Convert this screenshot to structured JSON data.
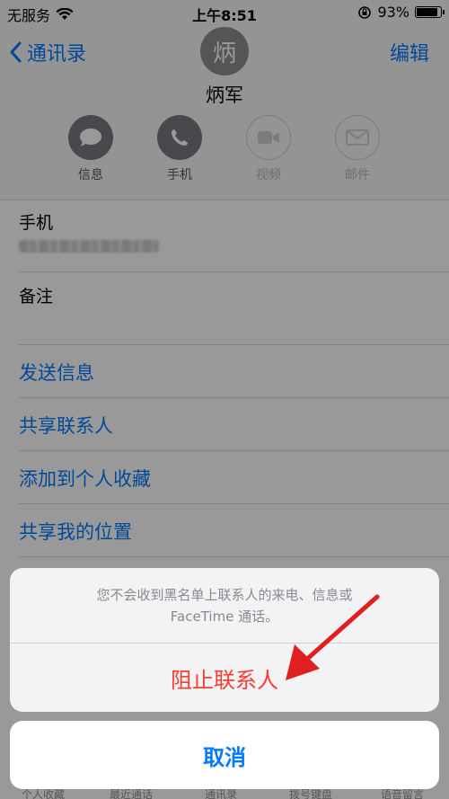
{
  "status_bar": {
    "carrier": "无服务",
    "time": "上午8:51",
    "battery": "93%",
    "battery_level": 0.93
  },
  "nav": {
    "back_label": "通讯录",
    "edit_label": "编辑"
  },
  "contact": {
    "avatar_initial": "炳",
    "name": "炳军"
  },
  "actions": [
    {
      "label": "信息",
      "icon": "message-bubble-icon",
      "enabled": true
    },
    {
      "label": "手机",
      "icon": "phone-icon",
      "enabled": true
    },
    {
      "label": "视频",
      "icon": "video-camera-icon",
      "enabled": false
    },
    {
      "label": "邮件",
      "icon": "mail-envelope-icon",
      "enabled": false
    }
  ],
  "fields": {
    "phone_label": "手机",
    "notes_label": "备注"
  },
  "links": [
    "发送信息",
    "共享联系人",
    "添加到个人收藏",
    "共享我的位置"
  ],
  "sheet": {
    "message_line1": "您不会收到黑名单上联系人的来电、信息或",
    "message_line2": "FaceTime 通话。",
    "block_label": "阻止联系人",
    "cancel_label": "取消"
  },
  "tabbar": [
    "个人收藏",
    "最近通话",
    "通讯录",
    "拨号键盘",
    "语音留言"
  ],
  "colors": {
    "ios_blue": "#007aff",
    "destructive_red": "#ff3b30",
    "annotation_arrow": "#e02020"
  }
}
